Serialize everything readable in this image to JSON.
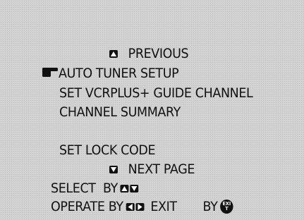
{
  "menu": {
    "previous_label": "PREVIOUS",
    "items": [
      {
        "label": "AUTO TUNER SETUP",
        "selected": true
      },
      {
        "label": "SET VCRPLUS+ GUIDE CHANNEL",
        "selected": false
      },
      {
        "label": "CHANNEL SUMMARY",
        "selected": false
      },
      {
        "label": "SET LOCK CODE",
        "selected": false
      }
    ],
    "next_label": "NEXT PAGE"
  },
  "instructions": {
    "select_label": "SELECT  BY",
    "operate_label": "OPERATE BY",
    "exit_label": "EXIT",
    "by_label": "BY",
    "exit_button_text": "EXIT"
  },
  "colors": {
    "background": "#d2d2d2",
    "text": "#111111"
  },
  "icons": {
    "previous": "up-arrow-key-icon",
    "next": "down-arrow-key-icon",
    "selection": "pointing-hand-cursor-icon",
    "select_keys": [
      "up-arrow-key-icon",
      "down-arrow-key-icon"
    ],
    "operate_keys": [
      "left-arrow-key-icon",
      "right-arrow-key-icon"
    ],
    "exit": "exit-button-icon"
  }
}
